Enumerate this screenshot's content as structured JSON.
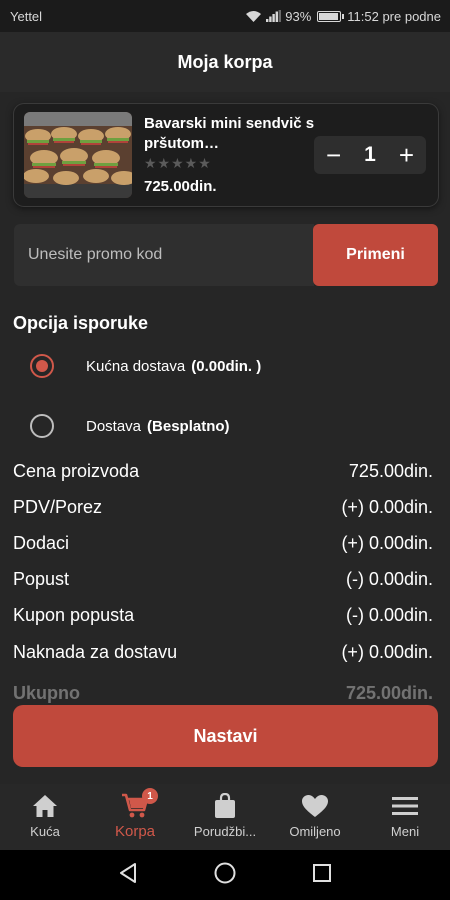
{
  "status_bar": {
    "carrier": "Yettel",
    "battery": "93%",
    "battery_level": 0.93,
    "time": "11:52 pre podne",
    "icons": [
      "wifi-icon",
      "signal-icon",
      "battery-icon"
    ]
  },
  "header": {
    "title": "Moja korpa"
  },
  "cart_item": {
    "name": "Bavarski mini sendvič s pršutom…",
    "rating": "★★★★★",
    "rating_value": 0,
    "price": "725.00din.",
    "quantity": "1",
    "minus_label": "−",
    "plus_label": "+"
  },
  "promo": {
    "placeholder": "Unesite promo kod",
    "value": "",
    "apply_label": "Primeni"
  },
  "delivery": {
    "title": "Opcija isporuke",
    "options": [
      {
        "label": "Kućna dostava",
        "value": "(0.00din. )",
        "selected": true
      },
      {
        "label": "Dostava",
        "value": "(Besplatno)",
        "selected": false
      }
    ]
  },
  "summary": {
    "rows": [
      {
        "label": "Cena proizvoda",
        "value": "725.00din."
      },
      {
        "label": "PDV/Porez",
        "value": "(+) 0.00din."
      },
      {
        "label": "Dodaci",
        "value": "(+) 0.00din."
      },
      {
        "label": "Popust",
        "value": "(-) 0.00din."
      },
      {
        "label": "Kupon popusta",
        "value": "(-) 0.00din."
      },
      {
        "label": "Naknada za dostavu",
        "value": "(+) 0.00din."
      }
    ],
    "total_partial": {
      "label": "Ukupno",
      "value": "725.00din."
    }
  },
  "continue_label": "Nastavi",
  "bottom_nav": {
    "items": [
      {
        "label": "Kuća",
        "icon": "home-icon",
        "active": false
      },
      {
        "label": "Korpa",
        "icon": "cart-icon",
        "active": true,
        "badge": "1"
      },
      {
        "label": "Porudžbi...",
        "icon": "shopping-bag-icon",
        "active": false
      },
      {
        "label": "Omiljeno",
        "icon": "heart-icon",
        "active": false
      },
      {
        "label": "Meni",
        "icon": "menu-icon",
        "active": false
      }
    ]
  },
  "system_nav": {
    "icons": [
      "back-icon",
      "home-circle-icon",
      "recents-icon"
    ]
  },
  "colors": {
    "accent": "#c0493c",
    "background": "#262626",
    "card": "#1d1d1d",
    "input": "#2f2f2f"
  }
}
